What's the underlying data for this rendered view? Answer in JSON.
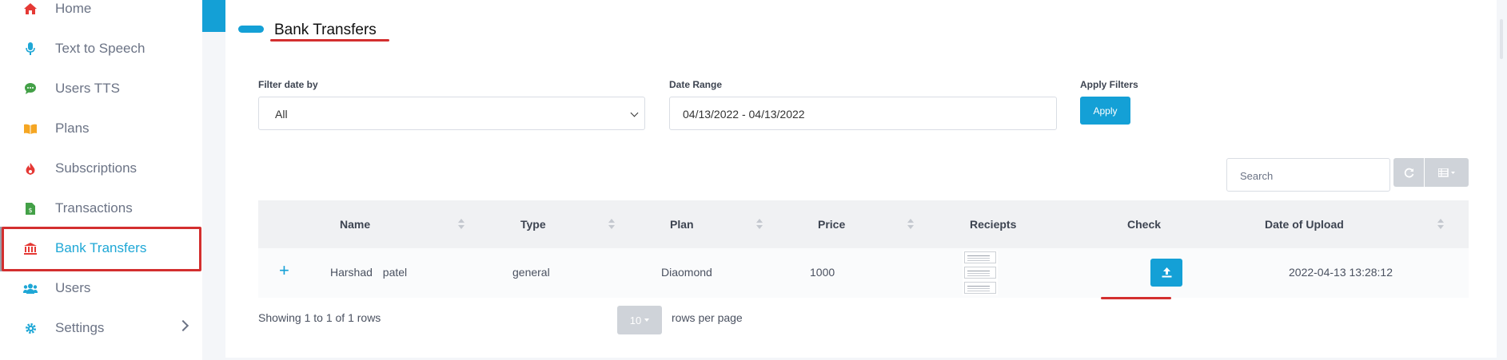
{
  "sidebar": {
    "items": [
      {
        "label": "Home",
        "icon": "home-icon",
        "color": "#e53935"
      },
      {
        "label": "Text to Speech",
        "icon": "microphone-icon",
        "color": "#1ea7d6"
      },
      {
        "label": "Users TTS",
        "icon": "chat-icon",
        "color": "#43a047"
      },
      {
        "label": "Plans",
        "icon": "book-icon",
        "color": "#f5a623"
      },
      {
        "label": "Subscriptions",
        "icon": "fire-icon",
        "color": "#e53935"
      },
      {
        "label": "Transactions",
        "icon": "file-dollar-icon",
        "color": "#43a047"
      },
      {
        "label": "Bank Transfers",
        "icon": "bank-icon",
        "color": "#e53935",
        "active": true
      },
      {
        "label": "Users",
        "icon": "users-icon",
        "color": "#1ea7d6"
      },
      {
        "label": "Settings",
        "icon": "gear-icon",
        "color": "#1ea7d6"
      }
    ]
  },
  "page": {
    "title": "Bank Transfers"
  },
  "filters": {
    "filter_date_label": "Filter date by",
    "filter_date_value": "All",
    "date_range_label": "Date Range",
    "date_range_value": "04/13/2022 - 04/13/2022",
    "apply_filters_label": "Apply Filters",
    "apply_button": "Apply"
  },
  "toolbar": {
    "search_placeholder": "Search"
  },
  "table": {
    "columns": [
      "Name",
      "Type",
      "Plan",
      "Price",
      "Reciepts",
      "Check",
      "Date of Upload"
    ],
    "rows": [
      {
        "expand": "+",
        "name": "Harshad patel",
        "type": "general",
        "plan": "Diaomond",
        "price": "1000",
        "date": "2022-04-13 13:28:12"
      }
    ]
  },
  "pagination": {
    "showing_text": "Showing 1 to 1 of 1 rows",
    "page_size": "10",
    "rows_per_page_text": "rows per page"
  },
  "colors": {
    "accent": "#14a0d6",
    "highlight_red": "#d32f2f"
  }
}
